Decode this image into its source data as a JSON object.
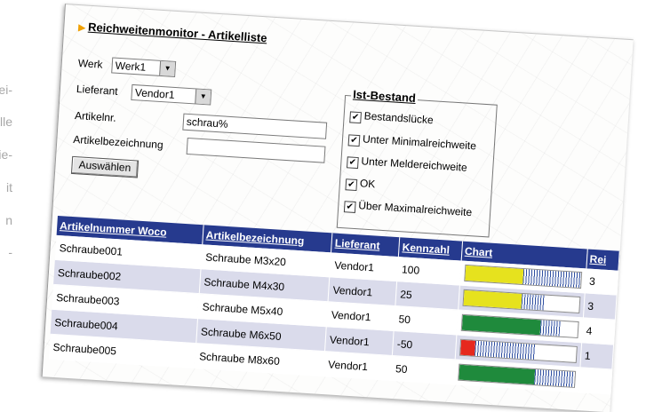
{
  "left_fragments": [
    "stei-",
    "alle",
    "nie-",
    "it",
    "n",
    "-"
  ],
  "title": "Reichweitenmonitor - Artikelliste",
  "form": {
    "werk_label": "Werk",
    "werk_value": "Werk1",
    "lieferant_label": "Lieferant",
    "lieferant_value": "Vendor1",
    "artikelnr_label": "Artikelnr.",
    "artikelnr_value": "schrau%",
    "artikelbez_label": "Artikelbezeichnung",
    "artikelbez_value": "",
    "submit_label": "Auswählen"
  },
  "ist_bestand": {
    "legend": "Ist-Bestand",
    "options": [
      {
        "label": "Bestandslücke",
        "checked": true
      },
      {
        "label": "Unter Minimalreichweite",
        "checked": true
      },
      {
        "label": "Unter Meldereichweite",
        "checked": true
      },
      {
        "label": "OK",
        "checked": true
      },
      {
        "label": "Über Maximalreichweite",
        "checked": true
      }
    ]
  },
  "table": {
    "headers": [
      "Artikelnummer Woco",
      "Artikelbezeichnung",
      "Lieferant",
      "Kennzahl",
      "Chart",
      "Rei"
    ],
    "rows": [
      {
        "nr": "Schraube001",
        "bez": "Schraube M3x20",
        "lief": "Vendor1",
        "kz": "100",
        "rei": "3",
        "bar_color": "#e6e21e",
        "fill": 0.5,
        "stripe": 0.5
      },
      {
        "nr": "Schraube002",
        "bez": "Schraube M4x30",
        "lief": "Vendor1",
        "kz": "25",
        "rei": "3",
        "bar_color": "#e6e21e",
        "fill": 0.5,
        "stripe": 0.2
      },
      {
        "nr": "Schraube003",
        "bez": "Schraube M5x40",
        "lief": "Vendor1",
        "kz": "50",
        "rei": "4",
        "bar_color": "#1f8a3c",
        "fill": 0.68,
        "stripe": 0.17
      },
      {
        "nr": "Schraube004",
        "bez": "Schraube M6x50",
        "lief": "Vendor1",
        "kz": "-50",
        "rei": "1",
        "bar_color": "#e6281e",
        "fill": 0.13,
        "stripe": 0.52
      },
      {
        "nr": "Schraube005",
        "bez": "Schraube M8x60",
        "lief": "Vendor1",
        "kz": "50",
        "rei": "",
        "bar_color": "#1f8a3c",
        "fill": 0.66,
        "stripe": 0.34
      }
    ]
  }
}
